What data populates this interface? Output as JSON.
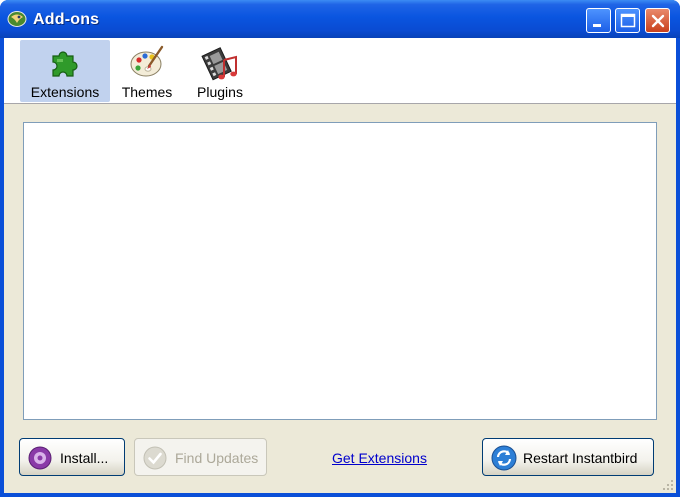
{
  "window": {
    "title": "Add-ons"
  },
  "toolbar": {
    "items": [
      {
        "label": "Extensions",
        "icon": "puzzle-piece-icon",
        "selected": true
      },
      {
        "label": "Themes",
        "icon": "paint-palette-icon",
        "selected": false
      },
      {
        "label": "Plugins",
        "icon": "film-music-icon",
        "selected": false
      }
    ]
  },
  "buttons": {
    "install": "Install...",
    "find_updates": "Find Updates",
    "get_extensions": "Get Extensions",
    "restart": "Restart Instantbird"
  },
  "colors": {
    "titlebar": "#0a4fd8",
    "frame": "#ece9d8",
    "selected_tab": "#c1d2ee",
    "link": "#0000cc"
  }
}
